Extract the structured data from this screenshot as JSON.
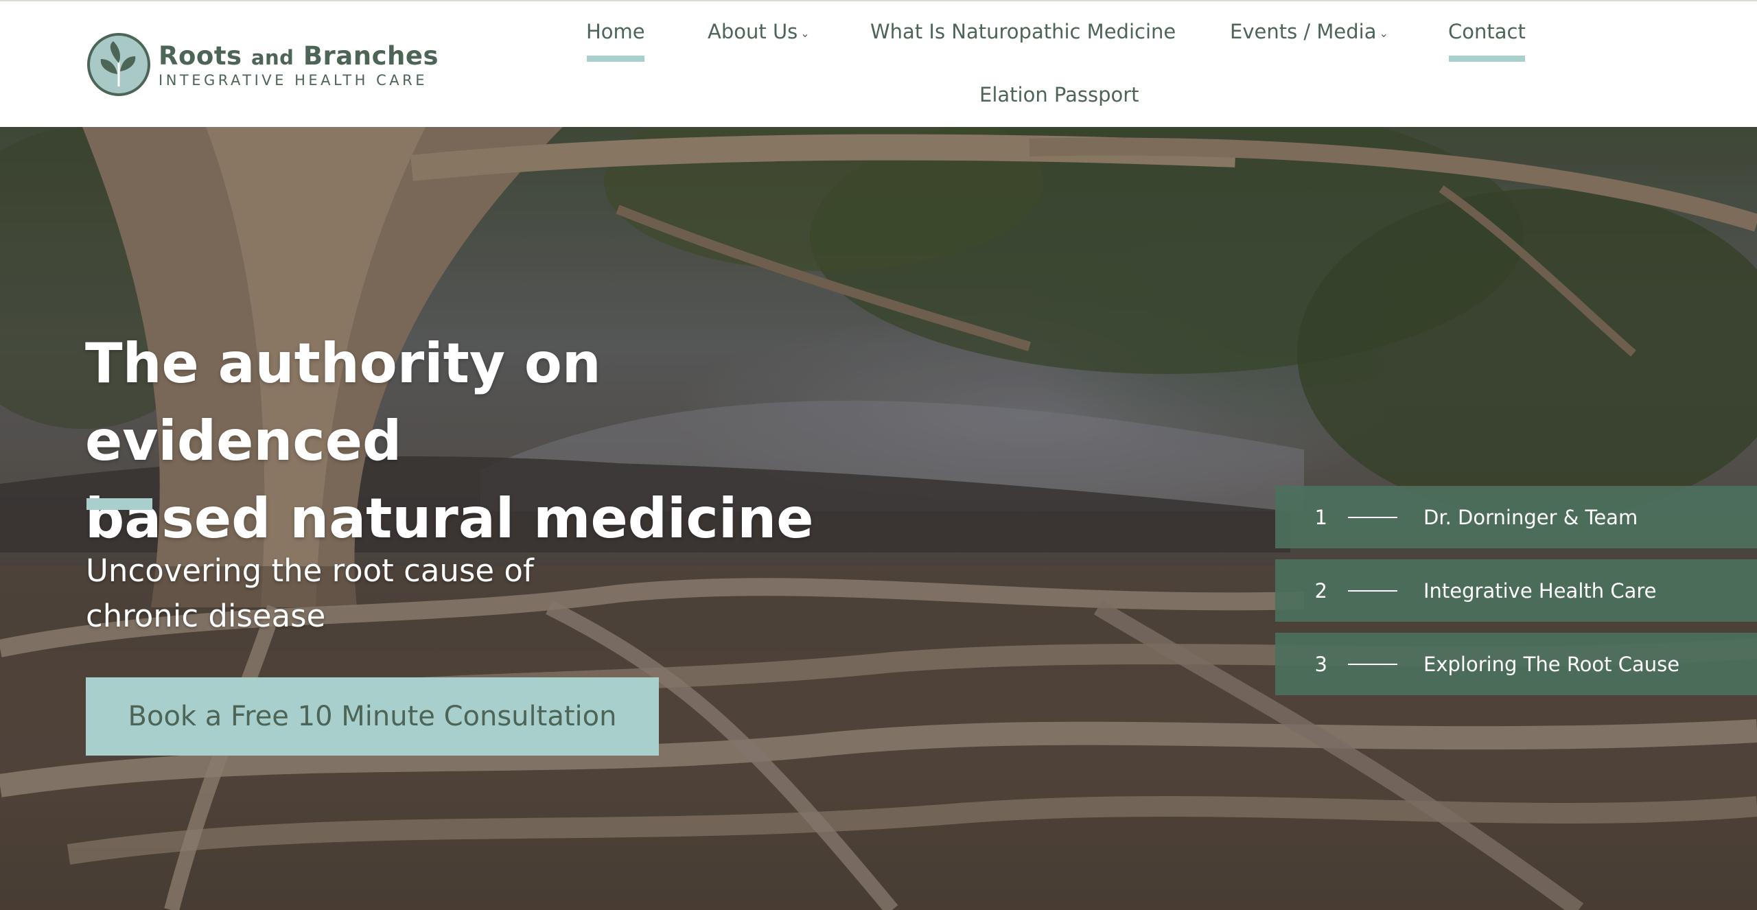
{
  "brand": {
    "name_part1": "Roots",
    "name_and": "and",
    "name_part2": "Branches",
    "tagline": "INTEGRATIVE HEALTH CARE",
    "colors": {
      "primary": "#4c6557",
      "accent": "#a9cfcc",
      "slide_bg": "#4c705c"
    }
  },
  "nav": {
    "home": "Home",
    "about": "About Us",
    "naturopathic": "What Is Naturopathic Medicine",
    "events": "Events / Media",
    "contact": "Contact",
    "elation": "Elation Passport",
    "dropdown_icon": "chevron-down-icon"
  },
  "hero": {
    "headline_line1": "The authority on evidenced",
    "headline_line2": "based natural medicine",
    "subheadline_line1": "Uncovering the root cause of",
    "subheadline_line2": "chronic disease",
    "cta_label": "Book a Free 10 Minute Consultation",
    "background_image": "tree-roots-photo"
  },
  "slides": [
    {
      "number": "1",
      "label": "Dr. Dorninger & Team"
    },
    {
      "number": "2",
      "label": "Integrative Health Care"
    },
    {
      "number": "3",
      "label": "Exploring The Root Cause"
    }
  ]
}
